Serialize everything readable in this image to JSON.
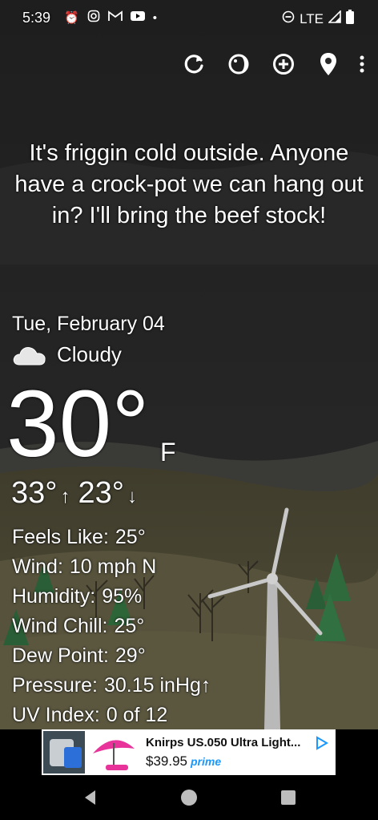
{
  "status": {
    "time": "5:39",
    "network": "LTE",
    "icons_left": [
      "alarm-icon",
      "instagram-icon",
      "gmail-icon",
      "youtube-icon",
      "dot-icon"
    ],
    "icons_right": [
      "dnd-icon",
      "signal-icon",
      "battery-icon"
    ]
  },
  "toolbar": {
    "buttons": [
      "refresh-icon",
      "theme-icon",
      "add-location-icon",
      "location-pin-icon",
      "overflow-menu-icon"
    ]
  },
  "quote": "It's friggin cold outside. Anyone have a crock-pot we can hang out in? I'll bring the beef stock!",
  "weather": {
    "date": "Tue, February 04",
    "condition": "Cloudy",
    "temp": "30°",
    "unit": "F",
    "high": "33°",
    "low": "23°",
    "high_arrow": "↑",
    "low_arrow": "↓",
    "details": [
      {
        "k": "Feels Like:",
        "v": "25°"
      },
      {
        "k": "Wind:",
        "v": "10 mph N"
      },
      {
        "k": "Humidity:",
        "v": "95%"
      },
      {
        "k": "Wind Chill:",
        "v": "25°"
      },
      {
        "k": "Dew Point:",
        "v": "29°"
      },
      {
        "k": "Pressure:",
        "v": "30.15 inHg↑"
      },
      {
        "k": "UV Index:",
        "v": "0 of 12"
      }
    ]
  },
  "ad": {
    "title": "Knirps US.050 Ultra Light...",
    "price": "$39.95",
    "prime": "prime"
  },
  "colors": {
    "sky_top": "#1c1c1c",
    "sky_bottom": "#2f2f2f",
    "ground": "#4e4a33",
    "accent_prime": "#1a98ff"
  }
}
